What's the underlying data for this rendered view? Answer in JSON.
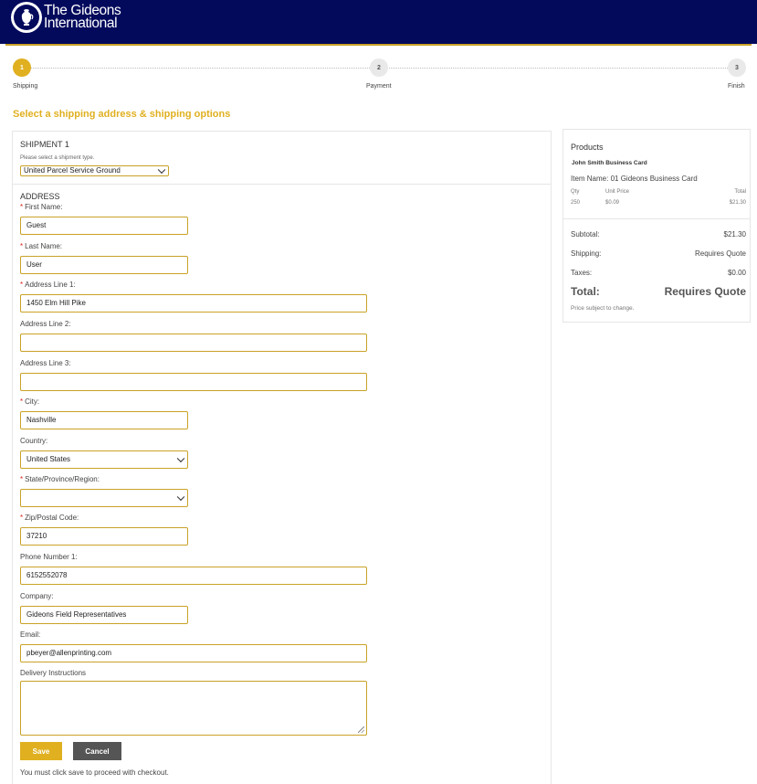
{
  "brand": {
    "name_line1": "The Gideons",
    "name_line2": "International"
  },
  "steps": [
    {
      "number": "1",
      "label": "Shipping",
      "active": true
    },
    {
      "number": "2",
      "label": "Payment",
      "active": false
    },
    {
      "number": "3",
      "label": "Finish",
      "active": false
    }
  ],
  "page_title": "Select a shipping address & shipping options",
  "shipment": {
    "title": "SHIPMENT 1",
    "hint": "Please select a shipment type.",
    "selected_type": "United Parcel Service Ground"
  },
  "address": {
    "title": "ADDRESS",
    "first_name": {
      "label": "First Name:",
      "value": "Guest"
    },
    "last_name": {
      "label": "Last Name:",
      "value": "User"
    },
    "address1": {
      "label": "Address Line 1:",
      "value": "1450 Elm Hill Pike"
    },
    "address2": {
      "label": "Address Line 2:",
      "value": ""
    },
    "address3": {
      "label": "Address Line 3:",
      "value": ""
    },
    "city": {
      "label": "City:",
      "value": "Nashville"
    },
    "country": {
      "label": "Country:",
      "value": "United States"
    },
    "state": {
      "label": "State/Province/Region:",
      "value": ""
    },
    "zip": {
      "label": "Zip/Postal Code:",
      "value": "37210"
    },
    "phone": {
      "label": "Phone Number 1:",
      "value": "6152552078"
    },
    "company": {
      "label": "Company:",
      "value": "Gideons Field Representatives"
    },
    "email": {
      "label": "Email:",
      "value": "pbeyer@allenprinting.com"
    },
    "instructions": {
      "label": "Delivery Instructions",
      "value": ""
    }
  },
  "required_marker": "*",
  "buttons": {
    "save": "Save",
    "cancel": "Cancel"
  },
  "save_note": "You must click save to proceed with checkout.",
  "summary": {
    "title": "Products",
    "product_name": "John Smith Business Card",
    "item_name": "Item Name: 01 Gideons Business Card",
    "columns": {
      "qty": "Qty",
      "unit_price": "Unit Price",
      "total": "Total"
    },
    "row": {
      "qty": "250",
      "unit_price": "$0.09",
      "total": "$21.30"
    },
    "subtotal_label": "Subtotal:",
    "subtotal": "$21.30",
    "shipping_label": "Shipping:",
    "shipping": "Requires Quote",
    "taxes_label": "Taxes:",
    "taxes": "$0.00",
    "total_label": "Total:",
    "total": "Requires Quote",
    "price_note": "Price subject to change."
  },
  "colors": {
    "header_bg": "#030a5c",
    "accent": "#e0b020",
    "required": "#d9261c",
    "cancel_bg": "#555555"
  }
}
